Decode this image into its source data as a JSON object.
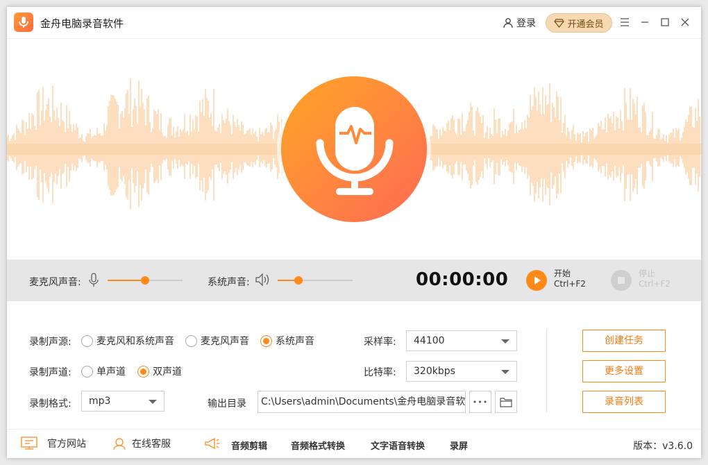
{
  "app": {
    "title": "金舟电脑录音软件",
    "login": "登录",
    "vip": "开通会员"
  },
  "controls": {
    "mic_label": "麦克风声音:",
    "mic_level": 0.5,
    "sys_label": "系统声音:",
    "sys_level": 0.28,
    "timer": "00:00:00",
    "start_label": "开始",
    "start_shortcut": "Ctrl+F2",
    "stop_label": "停止",
    "stop_shortcut": "Ctrl+F2"
  },
  "settings": {
    "source_label": "录制声源:",
    "source_options": [
      "麦克风和系统声音",
      "麦克风声音",
      "系统声音"
    ],
    "source_selected": "系统声音",
    "channel_label": "录制声道:",
    "channel_options": [
      "单声道",
      "双声道"
    ],
    "channel_selected": "双声道",
    "format_label": "录制格式:",
    "format_value": "mp3",
    "output_label": "输出目录",
    "output_path": "C:\\Users\\admin\\Documents\\金舟电脑录音软",
    "samplerate_label": "采样率:",
    "samplerate_value": "44100",
    "bitrate_label": "比特率:",
    "bitrate_value": "320kbps",
    "more_icon_text": "•••"
  },
  "actions": {
    "create_task": "创建任务",
    "more_settings": "更多设置",
    "record_list": "录音列表"
  },
  "bottom": {
    "website": "官方网站",
    "service": "在线客服",
    "tools": [
      "音频剪辑",
      "音频格式转换",
      "文字语音转换",
      "录屏"
    ],
    "version": "版本：v3.6.0"
  },
  "colors": {
    "accent": "#ff8a1a",
    "wave": "#fcd0a4",
    "vip_bg": "#f6d8b1"
  }
}
